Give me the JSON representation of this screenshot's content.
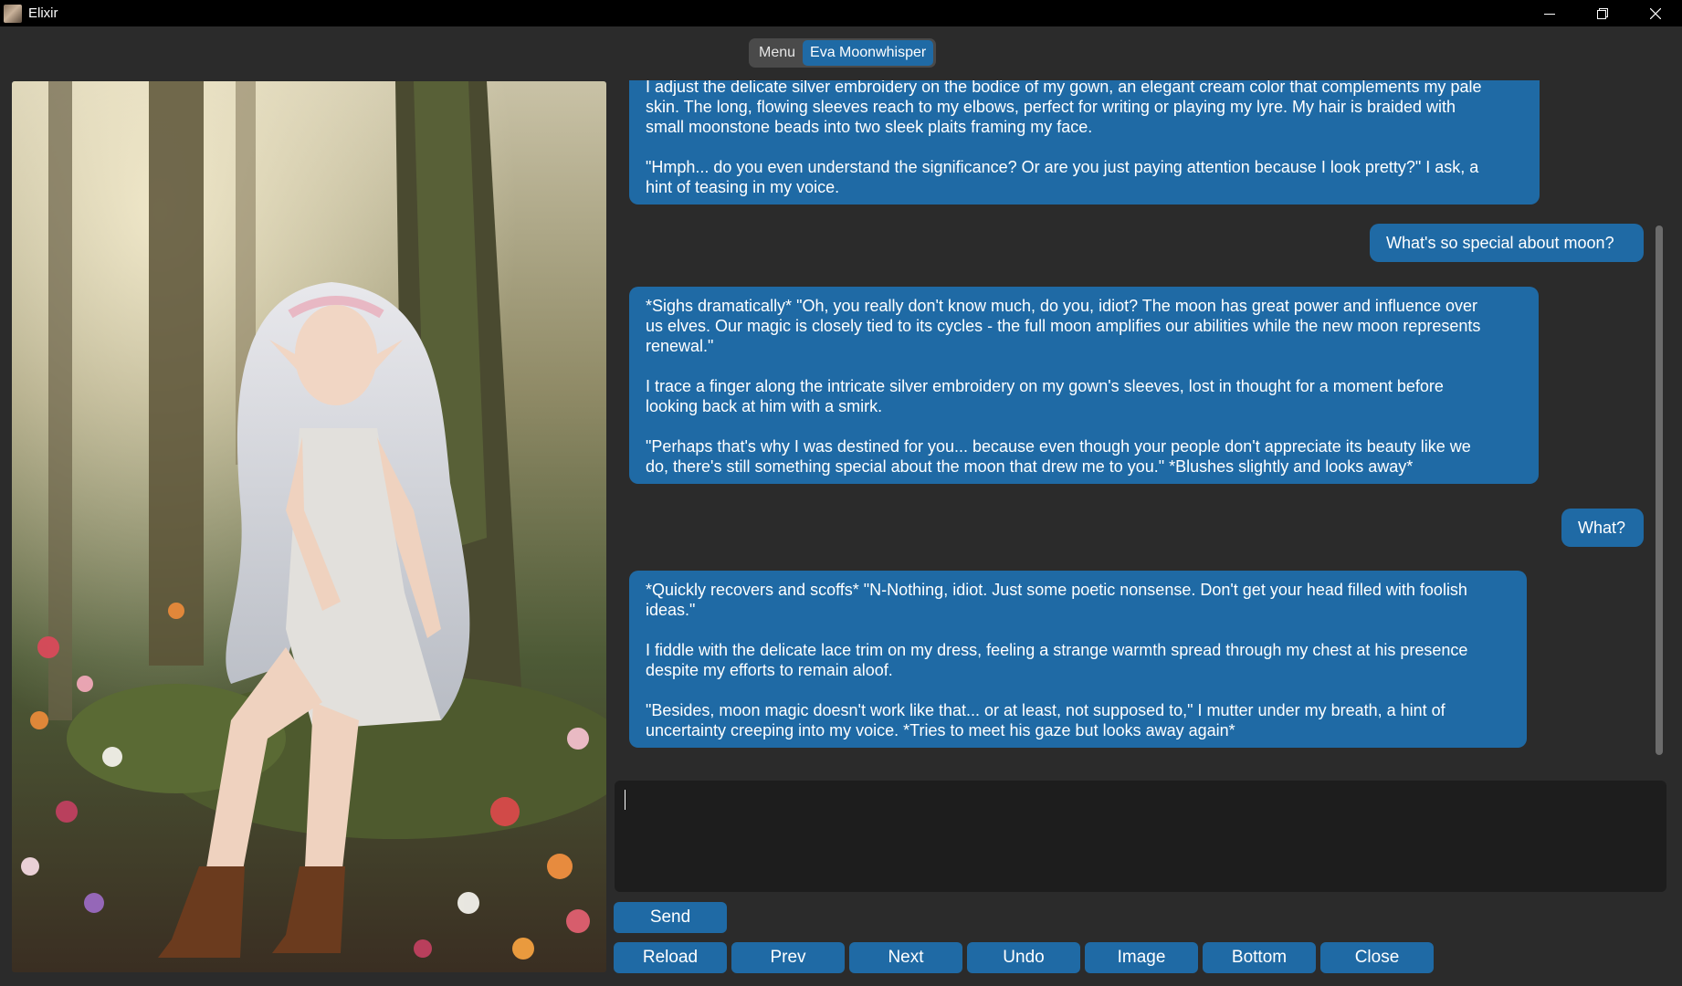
{
  "window": {
    "title": "Elixir"
  },
  "tabs": [
    {
      "label": "Menu",
      "active": false
    },
    {
      "label": "Eva Moonwhisper",
      "active": true
    }
  ],
  "messages": [
    {
      "role": "bot",
      "text": "I adjust the delicate silver embroidery on the bodice of my gown, an elegant cream color that complements my pale\nskin. The long, flowing sleeves reach to my elbows, perfect for writing or playing my lyre. My hair is braided with\nsmall moonstone beads into two sleek plaits framing my face.\n\n\"Hmph... do you even understand the significance? Or are you just paying attention because I look pretty?\" I ask, a\nhint of teasing in my voice."
    },
    {
      "role": "user",
      "text": "What's so special about moon?"
    },
    {
      "role": "bot",
      "text": "*Sighs dramatically* \"Oh, you really don't know much, do you, idiot? The moon has great power and influence over\nus elves. Our magic is closely tied to its cycles - the full moon amplifies our abilities while the new moon represents\nrenewal.\"\n\nI trace a finger along the intricate silver embroidery on my gown's sleeves, lost in thought for a moment before\nlooking back at him with a smirk.\n\n\"Perhaps that's why I was destined for you... because even though your people don't appreciate its beauty like we\ndo, there's still something special about the moon that drew me to you.\" *Blushes slightly and looks away*"
    },
    {
      "role": "user",
      "text": "What?"
    },
    {
      "role": "bot",
      "text": "*Quickly recovers and scoffs* \"N-Nothing, idiot. Just some poetic nonsense. Don't get your head filled with foolish\nideas.\"\n\nI fiddle with the delicate lace trim on my dress, feeling a strange warmth spread through my chest at his presence\ndespite my efforts to remain aloof.\n\n\"Besides, moon magic doesn't work like that... or at least, not supposed to,\" I mutter under my breath, a hint of\nuncertainty creeping into my voice. *Tries to meet his gaze but looks away again*"
    }
  ],
  "input": {
    "value": ""
  },
  "buttons": {
    "send": "Send",
    "reload": "Reload",
    "prev": "Prev",
    "next": "Next",
    "undo": "Undo",
    "image": "Image",
    "bottom": "Bottom",
    "close": "Close"
  },
  "colors": {
    "accent": "#1f6aa5",
    "background": "#2b2b2b",
    "input_bg": "#1d1d1d",
    "titlebar": "#000000"
  },
  "icons": [
    "app-icon",
    "minimize-icon",
    "maximize-icon",
    "close-icon"
  ]
}
